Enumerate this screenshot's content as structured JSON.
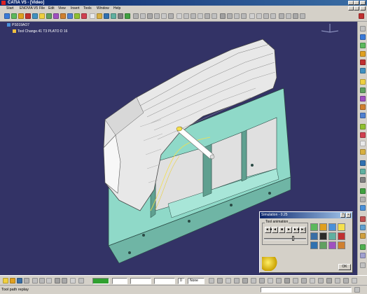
{
  "window": {
    "title": "CATIA V5 - [Video]"
  },
  "menu": [
    "Start",
    "ENOVIA V5",
    "File",
    "Edit",
    "View",
    "Insert",
    "Tools",
    "Window",
    "Help"
  ],
  "tree": {
    "root": "PS019AO7",
    "child": "Tool Change.41  T3 PLATO D 16"
  },
  "dialog": {
    "title": "Simulation - 0.25",
    "group_label": "Tool animation",
    "buttons": [
      "◄◄",
      "◄",
      "■",
      "►",
      "►►",
      "►|"
    ],
    "slider_value": 0.7,
    "ok_label": "OK"
  },
  "bottom_toolbar": {
    "line_field": "",
    "num_field": "0",
    "style_field": "None"
  },
  "status": {
    "text": "Tool path replay"
  },
  "colors": {
    "viewport_bg": "#333366",
    "fixture": "#8fd9c8",
    "part": "#e8e8e8",
    "tool": "#f4e04d"
  }
}
